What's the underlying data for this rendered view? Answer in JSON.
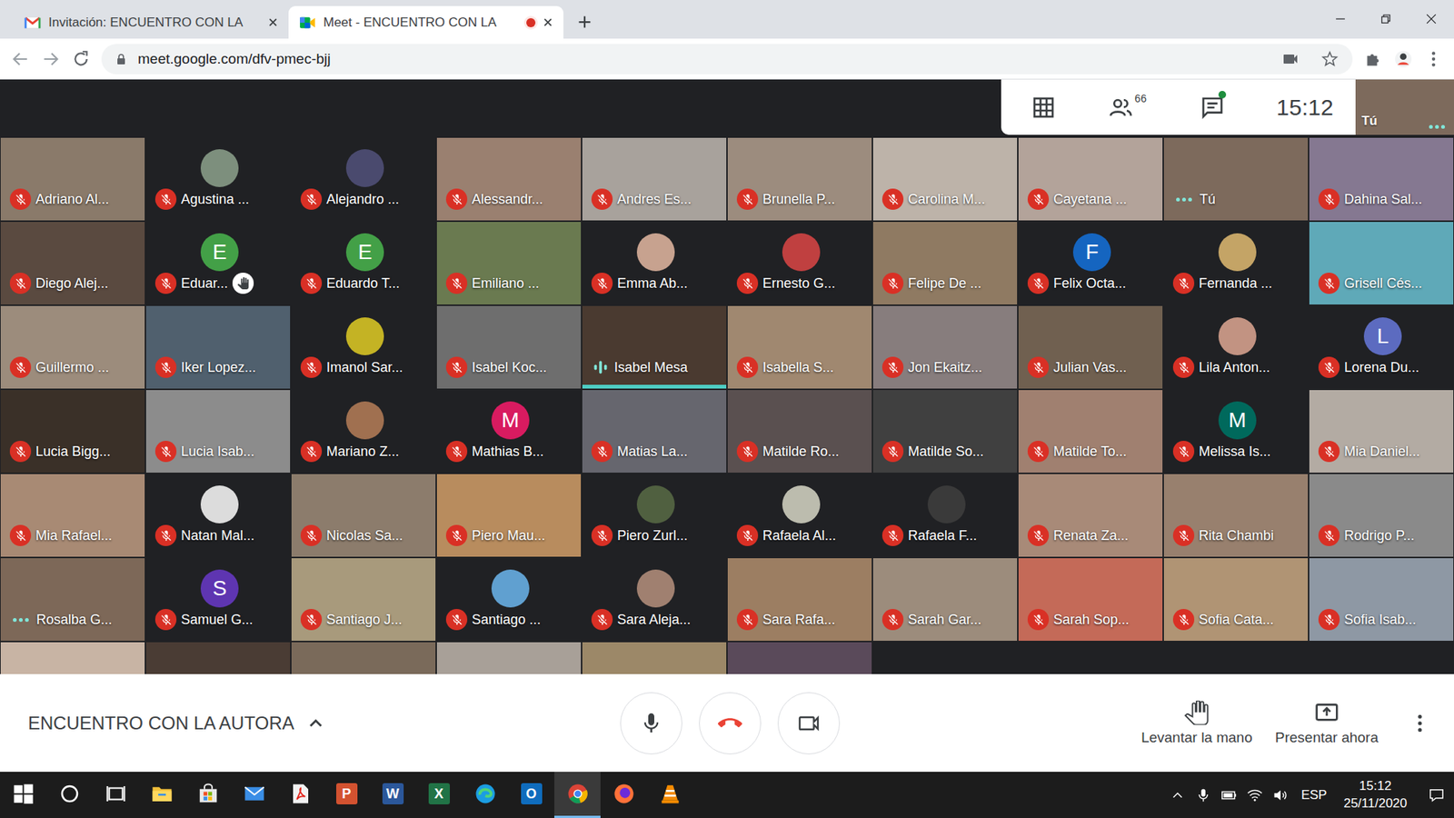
{
  "browser": {
    "tabs": [
      {
        "label": "Invitación: ENCUENTRO CON LA",
        "selected": false,
        "icon": "gmail",
        "recording": false
      },
      {
        "label": "Meet - ENCUENTRO CON LA",
        "selected": true,
        "icon": "meet",
        "recording": true
      }
    ],
    "url": "meet.google.com/dfv-pmec-bjj"
  },
  "meet": {
    "toolbar": {
      "people_count": "66",
      "chat_unread": true,
      "time": "15:12",
      "self_label": "Tú",
      "self_dots": true,
      "self_color": "#7d6a5c"
    },
    "participants": [
      {
        "name": "Adriano Al...",
        "kind": "video",
        "color": "#8a7a6a",
        "letter": "",
        "muted": true,
        "speaking": false,
        "dots": false,
        "hand_raised": false
      },
      {
        "name": "Agustina ...",
        "kind": "avatar",
        "color": "#7d8f7d",
        "letter": "",
        "muted": true,
        "speaking": false,
        "dots": false,
        "hand_raised": false
      },
      {
        "name": "Alejandro ...",
        "kind": "avatar",
        "color": "#4a4a6e",
        "letter": "",
        "muted": true,
        "speaking": false,
        "dots": false,
        "hand_raised": false
      },
      {
        "name": "Alessandr...",
        "kind": "video",
        "color": "#9a8070",
        "letter": "",
        "muted": true,
        "speaking": false,
        "dots": false,
        "hand_raised": false
      },
      {
        "name": "Andres Es...",
        "kind": "video",
        "color": "#a8a29c",
        "letter": "",
        "muted": true,
        "speaking": false,
        "dots": false,
        "hand_raised": false
      },
      {
        "name": "Brunella P...",
        "kind": "video",
        "color": "#9c8c7e",
        "letter": "",
        "muted": true,
        "speaking": false,
        "dots": false,
        "hand_raised": false
      },
      {
        "name": "Carolina M...",
        "kind": "video",
        "color": "#bdb3a9",
        "letter": "",
        "muted": true,
        "speaking": false,
        "dots": false,
        "hand_raised": false
      },
      {
        "name": "Cayetana ...",
        "kind": "video",
        "color": "#b3a39a",
        "letter": "",
        "muted": true,
        "speaking": false,
        "dots": false,
        "hand_raised": false
      },
      {
        "name": "Tú",
        "kind": "video",
        "color": "#7d6a5c",
        "letter": "",
        "muted": false,
        "speaking": false,
        "dots": true,
        "hand_raised": false
      },
      {
        "name": "Dahina Sal...",
        "kind": "video",
        "color": "#857891",
        "letter": "",
        "muted": true,
        "speaking": false,
        "dots": false,
        "hand_raised": false
      },
      {
        "name": "Diego Alej...",
        "kind": "video",
        "color": "#5a4a40",
        "letter": "",
        "muted": true,
        "speaking": false,
        "dots": false,
        "hand_raised": false
      },
      {
        "name": "Eduar...",
        "kind": "letter",
        "color": "#43a047",
        "letter": "E",
        "muted": true,
        "speaking": false,
        "dots": false,
        "hand_raised": true
      },
      {
        "name": "Eduardo T...",
        "kind": "letter",
        "color": "#43a047",
        "letter": "E",
        "muted": true,
        "speaking": false,
        "dots": false,
        "hand_raised": false
      },
      {
        "name": "Emiliano ...",
        "kind": "video",
        "color": "#6a7a50",
        "letter": "",
        "muted": true,
        "speaking": false,
        "dots": false,
        "hand_raised": false
      },
      {
        "name": "Emma Ab...",
        "kind": "avatar",
        "color": "#c7a28f",
        "letter": "",
        "muted": true,
        "speaking": false,
        "dots": false,
        "hand_raised": false
      },
      {
        "name": "Ernesto G...",
        "kind": "avatar",
        "color": "#c04040",
        "letter": "",
        "muted": true,
        "speaking": false,
        "dots": false,
        "hand_raised": false
      },
      {
        "name": "Felipe De ...",
        "kind": "video",
        "color": "#8f7a62",
        "letter": "",
        "muted": true,
        "speaking": false,
        "dots": false,
        "hand_raised": false
      },
      {
        "name": "Felix Octa...",
        "kind": "letter",
        "color": "#1565c0",
        "letter": "F",
        "muted": true,
        "speaking": false,
        "dots": false,
        "hand_raised": false
      },
      {
        "name": "Fernanda ...",
        "kind": "avatar",
        "color": "#c4a466",
        "letter": "",
        "muted": true,
        "speaking": false,
        "dots": false,
        "hand_raised": false
      },
      {
        "name": "Grisell Cés...",
        "kind": "video",
        "color": "#5fa9b8",
        "letter": "",
        "muted": true,
        "speaking": false,
        "dots": false,
        "hand_raised": false
      },
      {
        "name": "Guillermo ...",
        "kind": "video",
        "color": "#9c8c7c",
        "letter": "",
        "muted": true,
        "speaking": false,
        "dots": false,
        "hand_raised": false
      },
      {
        "name": "Iker Lopez...",
        "kind": "video",
        "color": "#50606e",
        "letter": "",
        "muted": true,
        "speaking": false,
        "dots": false,
        "hand_raised": false
      },
      {
        "name": "Imanol Sar...",
        "kind": "avatar",
        "color": "#c4b324",
        "letter": "",
        "muted": true,
        "speaking": false,
        "dots": false,
        "hand_raised": false
      },
      {
        "name": "Isabel Koc...",
        "kind": "video",
        "color": "#6e6e6e",
        "letter": "",
        "muted": true,
        "speaking": false,
        "dots": false,
        "hand_raised": false
      },
      {
        "name": "Isabel Mesa",
        "kind": "video",
        "color": "#4a3a30",
        "letter": "",
        "muted": false,
        "speaking": true,
        "dots": false,
        "hand_raised": false
      },
      {
        "name": "Isabella S...",
        "kind": "video",
        "color": "#a08870",
        "letter": "",
        "muted": true,
        "speaking": false,
        "dots": false,
        "hand_raised": false
      },
      {
        "name": "Jon Ekaitz...",
        "kind": "video",
        "color": "#877d7d",
        "letter": "",
        "muted": true,
        "speaking": false,
        "dots": false,
        "hand_raised": false
      },
      {
        "name": "Julian Vas...",
        "kind": "video",
        "color": "#706050",
        "letter": "",
        "muted": true,
        "speaking": false,
        "dots": false,
        "hand_raised": false
      },
      {
        "name": "Lila Anton...",
        "kind": "avatar",
        "color": "#c29382",
        "letter": "",
        "muted": true,
        "speaking": false,
        "dots": false,
        "hand_raised": false
      },
      {
        "name": "Lorena Du...",
        "kind": "letter",
        "color": "#5c6bc0",
        "letter": "L",
        "muted": true,
        "speaking": false,
        "dots": false,
        "hand_raised": false
      },
      {
        "name": "Lucia Bigg...",
        "kind": "video",
        "color": "#3a3028",
        "letter": "",
        "muted": true,
        "speaking": false,
        "dots": false,
        "hand_raised": false
      },
      {
        "name": "Lucia Isab...",
        "kind": "video",
        "color": "#8c8c8c",
        "letter": "",
        "muted": true,
        "speaking": false,
        "dots": false,
        "hand_raised": false
      },
      {
        "name": "Mariano Z...",
        "kind": "avatar",
        "color": "#a07050",
        "letter": "",
        "muted": true,
        "speaking": false,
        "dots": false,
        "hand_raised": false
      },
      {
        "name": "Mathias B...",
        "kind": "letter",
        "color": "#d81b60",
        "letter": "M",
        "muted": true,
        "speaking": false,
        "dots": false,
        "hand_raised": false
      },
      {
        "name": "Matias La...",
        "kind": "video",
        "color": "#66666e",
        "letter": "",
        "muted": true,
        "speaking": false,
        "dots": false,
        "hand_raised": false
      },
      {
        "name": "Matilde Ro...",
        "kind": "video",
        "color": "#5a5050",
        "letter": "",
        "muted": true,
        "speaking": false,
        "dots": false,
        "hand_raised": false
      },
      {
        "name": "Matilde So...",
        "kind": "video",
        "color": "#404040",
        "letter": "",
        "muted": true,
        "speaking": false,
        "dots": false,
        "hand_raised": false
      },
      {
        "name": "Matilde To...",
        "kind": "video",
        "color": "#a08070",
        "letter": "",
        "muted": true,
        "speaking": false,
        "dots": false,
        "hand_raised": false
      },
      {
        "name": "Melissa Is...",
        "kind": "letter",
        "color": "#00695c",
        "letter": "M",
        "muted": true,
        "speaking": false,
        "dots": false,
        "hand_raised": false
      },
      {
        "name": "Mia Daniel...",
        "kind": "video",
        "color": "#b3aba3",
        "letter": "",
        "muted": true,
        "speaking": false,
        "dots": false,
        "hand_raised": false
      },
      {
        "name": "Mia Rafael...",
        "kind": "video",
        "color": "#a88a74",
        "letter": "",
        "muted": true,
        "speaking": false,
        "dots": false,
        "hand_raised": false
      },
      {
        "name": "Natan Mal...",
        "kind": "avatar",
        "color": "#dcdcdc",
        "letter": "",
        "muted": true,
        "speaking": false,
        "dots": false,
        "hand_raised": false
      },
      {
        "name": "Nicolas Sa...",
        "kind": "video",
        "color": "#8c7c6c",
        "letter": "",
        "muted": true,
        "speaking": false,
        "dots": false,
        "hand_raised": false
      },
      {
        "name": "Piero Mau...",
        "kind": "video",
        "color": "#b88c5e",
        "letter": "",
        "muted": true,
        "speaking": false,
        "dots": false,
        "hand_raised": false
      },
      {
        "name": "Piero Zurl...",
        "kind": "avatar",
        "color": "#506040",
        "letter": "",
        "muted": true,
        "speaking": false,
        "dots": false,
        "hand_raised": false
      },
      {
        "name": "Rafaela Al...",
        "kind": "avatar",
        "color": "#bcbcae",
        "letter": "",
        "muted": true,
        "speaking": false,
        "dots": false,
        "hand_raised": false
      },
      {
        "name": "Rafaela F...",
        "kind": "avatar",
        "color": "#3a3a3a",
        "letter": "",
        "muted": true,
        "speaking": false,
        "dots": false,
        "hand_raised": false
      },
      {
        "name": "Renata Za...",
        "kind": "video",
        "color": "#a88a78",
        "letter": "",
        "muted": true,
        "speaking": false,
        "dots": false,
        "hand_raised": false
      },
      {
        "name": "Rita Chambi",
        "kind": "video",
        "color": "#98806e",
        "letter": "",
        "muted": true,
        "speaking": false,
        "dots": false,
        "hand_raised": false
      },
      {
        "name": "Rodrigo P...",
        "kind": "video",
        "color": "#8a8a8a",
        "letter": "",
        "muted": true,
        "speaking": false,
        "dots": false,
        "hand_raised": false
      },
      {
        "name": "Rosalba G...",
        "kind": "video",
        "color": "#7d6858",
        "letter": "",
        "muted": false,
        "speaking": false,
        "dots": true,
        "hand_raised": false
      },
      {
        "name": "Samuel G...",
        "kind": "letter",
        "color": "#5e35b1",
        "letter": "S",
        "muted": true,
        "speaking": false,
        "dots": false,
        "hand_raised": false
      },
      {
        "name": "Santiago J...",
        "kind": "video",
        "color": "#a89a7c",
        "letter": "",
        "muted": true,
        "speaking": false,
        "dots": false,
        "hand_raised": false
      },
      {
        "name": "Santiago ...",
        "kind": "avatar",
        "color": "#60a0d0",
        "letter": "",
        "muted": true,
        "speaking": false,
        "dots": false,
        "hand_raised": false
      },
      {
        "name": "Sara Aleja...",
        "kind": "avatar",
        "color": "#a08070",
        "letter": "",
        "muted": true,
        "speaking": false,
        "dots": false,
        "hand_raised": false
      },
      {
        "name": "Sara Rafa...",
        "kind": "video",
        "color": "#9c7e62",
        "letter": "",
        "muted": true,
        "speaking": false,
        "dots": false,
        "hand_raised": false
      },
      {
        "name": "Sarah Gar...",
        "kind": "video",
        "color": "#9c8c7c",
        "letter": "",
        "muted": true,
        "speaking": false,
        "dots": false,
        "hand_raised": false
      },
      {
        "name": "Sarah Sop...",
        "kind": "video",
        "color": "#c46a58",
        "letter": "",
        "muted": true,
        "speaking": false,
        "dots": false,
        "hand_raised": false
      },
      {
        "name": "Sofia Cata...",
        "kind": "video",
        "color": "#b09474",
        "letter": "",
        "muted": true,
        "speaking": false,
        "dots": false,
        "hand_raised": false
      },
      {
        "name": "Sofia Isab...",
        "kind": "video",
        "color": "#8e98a4",
        "letter": "",
        "muted": true,
        "speaking": false,
        "dots": false,
        "hand_raised": false
      }
    ],
    "partial_tiles": [
      {
        "color": "#c8b4a4"
      },
      {
        "color": "#4a3c34"
      },
      {
        "color": "#7a6a5a"
      },
      {
        "color": "#a8a098"
      },
      {
        "color": "#9c8868"
      },
      {
        "color": "#5a4a5a"
      }
    ],
    "bottom": {
      "title": "ENCUENTRO CON LA AUTORA",
      "mic_on": true,
      "camera_on": true,
      "actions": [
        {
          "label": "Levantar la mano",
          "icon": "hand"
        },
        {
          "label": "Presentar ahora",
          "icon": "present"
        }
      ]
    }
  },
  "taskbar": {
    "apps": [
      {
        "kind": "start",
        "color": "#ffffff",
        "active": false,
        "glyph": ""
      },
      {
        "kind": "search",
        "color": "#ffffff",
        "active": false,
        "glyph": ""
      },
      {
        "kind": "taskview",
        "color": "#ffffff",
        "active": false,
        "glyph": ""
      },
      {
        "kind": "folder",
        "color": "#f3c13a",
        "active": false,
        "glyph": ""
      },
      {
        "kind": "store",
        "color": "#3a8ee6",
        "active": false,
        "glyph": ""
      },
      {
        "kind": "mail",
        "color": "#3a8ee6",
        "active": false,
        "glyph": ""
      },
      {
        "kind": "acrobat",
        "color": "#e2231a",
        "active": false,
        "glyph": ""
      },
      {
        "kind": "office",
        "color": "#d35230",
        "active": false,
        "glyph": "P"
      },
      {
        "kind": "office",
        "color": "#2b579a",
        "active": false,
        "glyph": "W"
      },
      {
        "kind": "office",
        "color": "#217346",
        "active": false,
        "glyph": "X"
      },
      {
        "kind": "edge",
        "color": "#1b9de2",
        "active": false,
        "glyph": ""
      },
      {
        "kind": "office",
        "color": "#0f6cbd",
        "active": false,
        "glyph": "O"
      },
      {
        "kind": "chrome",
        "color": "#4285f4",
        "active": true,
        "glyph": ""
      },
      {
        "kind": "firefox",
        "color": "#ff7139",
        "active": false,
        "glyph": ""
      },
      {
        "kind": "vlc",
        "color": "#f48b00",
        "active": false,
        "glyph": ""
      }
    ],
    "tray": {
      "language": "ESP",
      "time": "15:12",
      "date": "25/11/2020"
    }
  }
}
